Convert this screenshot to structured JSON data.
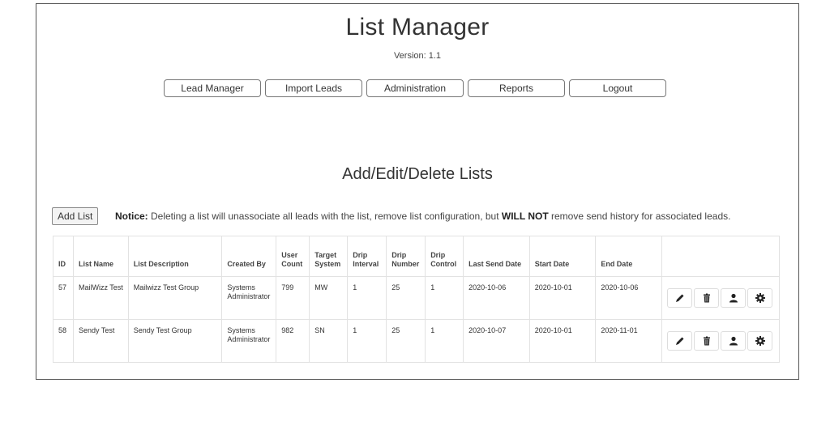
{
  "header": {
    "title": "List Manager",
    "version": "Version: 1.1"
  },
  "nav": [
    {
      "label": "Lead Manager"
    },
    {
      "label": "Import Leads"
    },
    {
      "label": "Administration"
    },
    {
      "label": "Reports"
    },
    {
      "label": "Logout"
    }
  ],
  "section": {
    "title": "Add/Edit/Delete Lists",
    "add_button": "Add List",
    "notice_label": "Notice:",
    "notice_text_1": " Deleting a list will unassociate all leads with the list, remove list configuration, but ",
    "notice_bold": "WILL NOT",
    "notice_text_2": " remove send history for associated leads."
  },
  "table": {
    "headers": {
      "id": "ID",
      "list_name": "List Name",
      "list_description": "List Description",
      "created_by": "Created By",
      "user_count": "User Count",
      "target_system": "Target System",
      "drip_interval": "Drip Interval",
      "drip_number": "Drip Number",
      "drip_control": "Drip Control",
      "last_send_date": "Last Send Date",
      "start_date": "Start Date",
      "end_date": "End Date",
      "actions": ""
    },
    "rows": [
      {
        "id": "57",
        "list_name": "MailWizz Test",
        "list_description": "Mailwizz Test Group",
        "created_by": "Systems Administrator",
        "user_count": "799",
        "target_system": "MW",
        "drip_interval": "1",
        "drip_number": "25",
        "drip_control": "1",
        "last_send_date": "2020-10-06",
        "start_date": "2020-10-01",
        "end_date": "2020-10-06"
      },
      {
        "id": "58",
        "list_name": "Sendy Test",
        "list_description": "Sendy Test Group",
        "created_by": "Systems Administrator",
        "user_count": "982",
        "target_system": "SN",
        "drip_interval": "1",
        "drip_number": "25",
        "drip_control": "1",
        "last_send_date": "2020-10-07",
        "start_date": "2020-10-01",
        "end_date": "2020-11-01"
      }
    ],
    "action_icons": [
      "pencil-icon",
      "trash-icon",
      "user-icon",
      "gear-icon"
    ]
  }
}
